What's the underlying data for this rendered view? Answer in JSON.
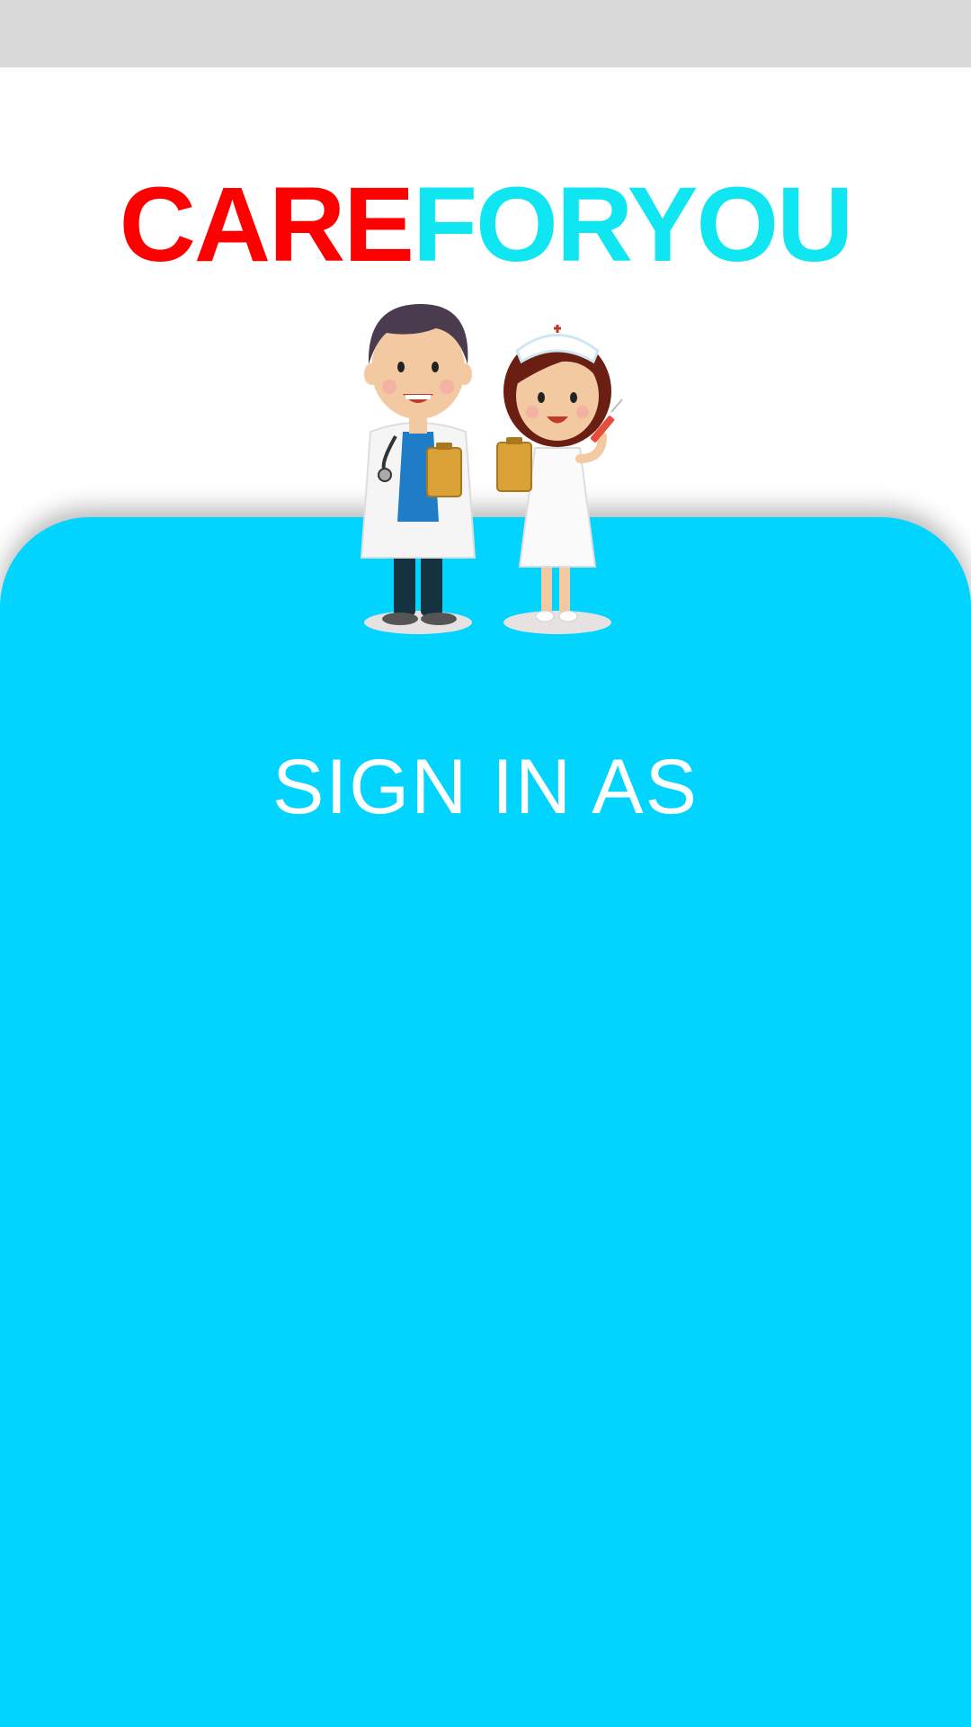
{
  "app": {
    "logo_part1": "CARE",
    "logo_part2": "FORYOU",
    "logo_color1": "#ff0000",
    "logo_color2": "#10e6f2"
  },
  "main": {
    "panel_color": "#00d4ff",
    "heading": "SIGN IN AS"
  },
  "illustration": {
    "icon": "doctor-and-nurse-illustration"
  }
}
